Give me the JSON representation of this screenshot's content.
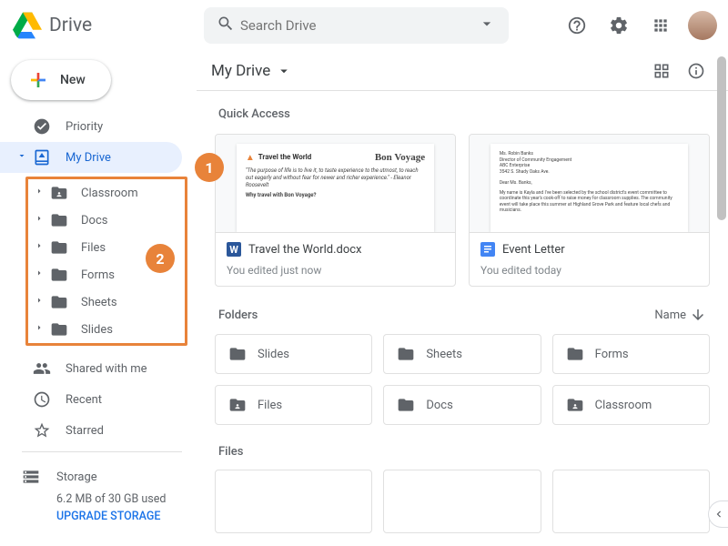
{
  "header": {
    "app_name": "Drive",
    "search_placeholder": "Search Drive"
  },
  "sidebar": {
    "new_label": "New",
    "items": [
      {
        "label": "Priority"
      },
      {
        "label": "My Drive"
      },
      {
        "label": "Shared with me"
      },
      {
        "label": "Recent"
      },
      {
        "label": "Starred"
      }
    ],
    "tree": {
      "folders": [
        {
          "label": "Classroom",
          "shared": true
        },
        {
          "label": "Docs",
          "shared": false
        },
        {
          "label": "Files",
          "shared": false
        },
        {
          "label": "Forms",
          "shared": false
        },
        {
          "label": "Sheets",
          "shared": false
        },
        {
          "label": "Slides",
          "shared": false
        }
      ]
    },
    "storage": {
      "title": "Storage",
      "used": "6.2 MB of 30 GB used",
      "upgrade": "UPGRADE STORAGE"
    }
  },
  "main": {
    "breadcrumb": "My Drive",
    "quick_access_title": "Quick Access",
    "quick_access": [
      {
        "name": "Travel the World.docx",
        "subtitle": "You edited just now",
        "type": "word",
        "preview_title": "Travel the World",
        "preview_sub": "Bon Voyage",
        "preview_body": "\"The purpose of life is to live it, to taste experience to the utmost, to reach out eagerly and without fear for newer and richer experience.\" - Eleanor Roosevelt",
        "preview_foot": "Why travel with Bon Voyage?"
      },
      {
        "name": "Event Letter",
        "subtitle": "You edited today",
        "type": "gdoc",
        "preview_addr": "Ms. Robin Banks\nDirector of Community Engagement\nABC Enterprise\n3542 S. Shady Oaks Ave.",
        "preview_salut": "Dear Ms. Banks,",
        "preview_body": "My name is Kayla and I've been selected by the school district's event committee to coordinate this year's cook-off to raise money for classroom supplies. The community event will take place this summer at Highland Grove Park and feature local chefs and musicians."
      }
    ],
    "folders_title": "Folders",
    "sort_label": "Name",
    "folders": [
      {
        "label": "Slides",
        "shared": false
      },
      {
        "label": "Sheets",
        "shared": false
      },
      {
        "label": "Forms",
        "shared": false
      },
      {
        "label": "Files",
        "shared": true
      },
      {
        "label": "Docs",
        "shared": false
      },
      {
        "label": "Classroom",
        "shared": true
      }
    ],
    "files_title": "Files"
  },
  "annotations": {
    "callout1": "1",
    "callout2": "2"
  }
}
